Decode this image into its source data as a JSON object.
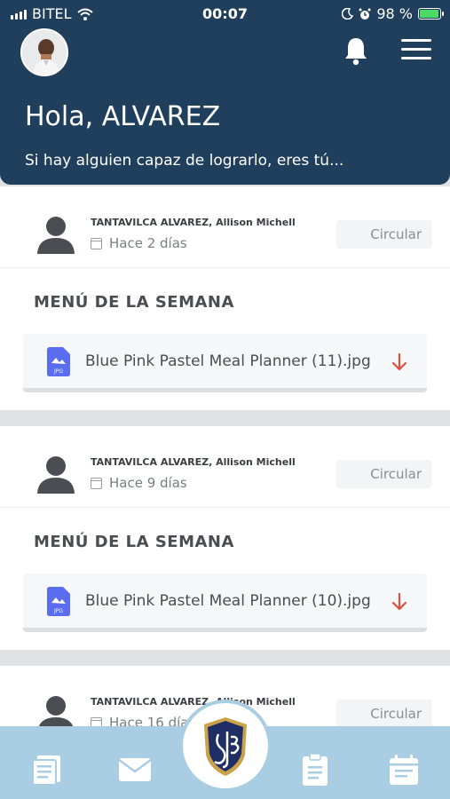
{
  "status": {
    "carrier": "BITEL",
    "time": "00:07",
    "battery": "98 %",
    "battery_level": 0.98
  },
  "header": {
    "greeting": "Hola,",
    "name": "ALVAREZ",
    "motto": "Si hay alguien capaz de lograrlo, eres tú..."
  },
  "icons": {
    "notifications": "bell-icon",
    "menu": "hamburger-menu-icon",
    "wifi": "wifi-icon",
    "moon": "moon-icon",
    "alarm": "alarm-clock-icon"
  },
  "posts": [
    {
      "author": "TANTAVILCA ALVAREZ, Allison Michell",
      "date": "Hace 2 días",
      "tag": "Circular",
      "title": "MENÚ DE LA SEMANA",
      "file_name": "Blue Pink Pastel Meal Planner (11).jpg",
      "file_type": "JPG"
    },
    {
      "author": "TANTAVILCA ALVAREZ, Allison Michell",
      "date": "Hace 9 días",
      "tag": "Circular",
      "title": "MENÚ DE LA SEMANA",
      "file_name": "Blue Pink Pastel Meal Planner (10).jpg",
      "file_type": "JPG"
    },
    {
      "author": "TANTAVILCA ALVAREZ, Allison Michell",
      "date": "Hace 16 días",
      "tag": "Circular"
    }
  ],
  "colors": {
    "header_bg": "#1f3f5c",
    "bottom_nav_bg": "#a9cde2",
    "download_arrow": "#e0503f",
    "file_icon": "#5a6df0"
  },
  "bottom_nav": [
    "news-icon",
    "mail-icon",
    "school-logo-icon",
    "clipboard-icon",
    "calendar-icon"
  ]
}
